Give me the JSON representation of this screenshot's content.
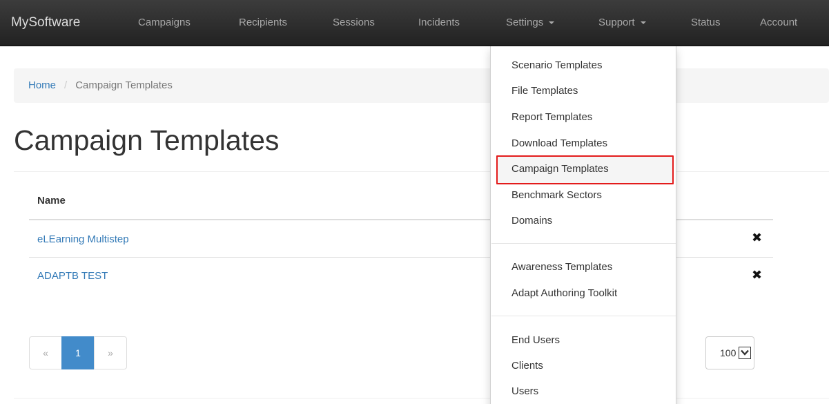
{
  "navbar": {
    "brand": "MySoftware",
    "items": [
      {
        "label": "Campaigns"
      },
      {
        "label": "Recipients"
      },
      {
        "label": "Sessions"
      },
      {
        "label": "Incidents"
      },
      {
        "label": "Settings",
        "has_caret": true
      },
      {
        "label": "Support",
        "has_caret": true
      },
      {
        "label": "Status"
      },
      {
        "label": "Account"
      }
    ]
  },
  "breadcrumb": {
    "home": "Home",
    "separator": "/",
    "current": "Campaign Templates"
  },
  "page": {
    "title": "Campaign Templates"
  },
  "table": {
    "column_name": "Name",
    "rows": [
      {
        "name": "eLEarning Multistep",
        "delete_icon": "✖"
      },
      {
        "name": "ADAPTB TEST",
        "delete_icon": "✖"
      }
    ]
  },
  "pagination": {
    "prev": "«",
    "current_page": "1",
    "next": "»"
  },
  "page_size": {
    "value": "100"
  },
  "settings_menu": {
    "groups": [
      [
        "Scenario Templates",
        "File Templates",
        "Report Templates",
        "Download Templates",
        "Campaign Templates",
        "Benchmark Sectors",
        "Domains"
      ],
      [
        "Awareness Templates",
        "Adapt Authoring Toolkit"
      ],
      [
        "End Users",
        "Clients",
        "Users"
      ]
    ],
    "highlighted_item": "Campaign Templates",
    "highlight_color": "#e31b1b"
  },
  "colors": {
    "link": "#337ab7",
    "active_page": "#428bca",
    "navbar": "#222222"
  }
}
